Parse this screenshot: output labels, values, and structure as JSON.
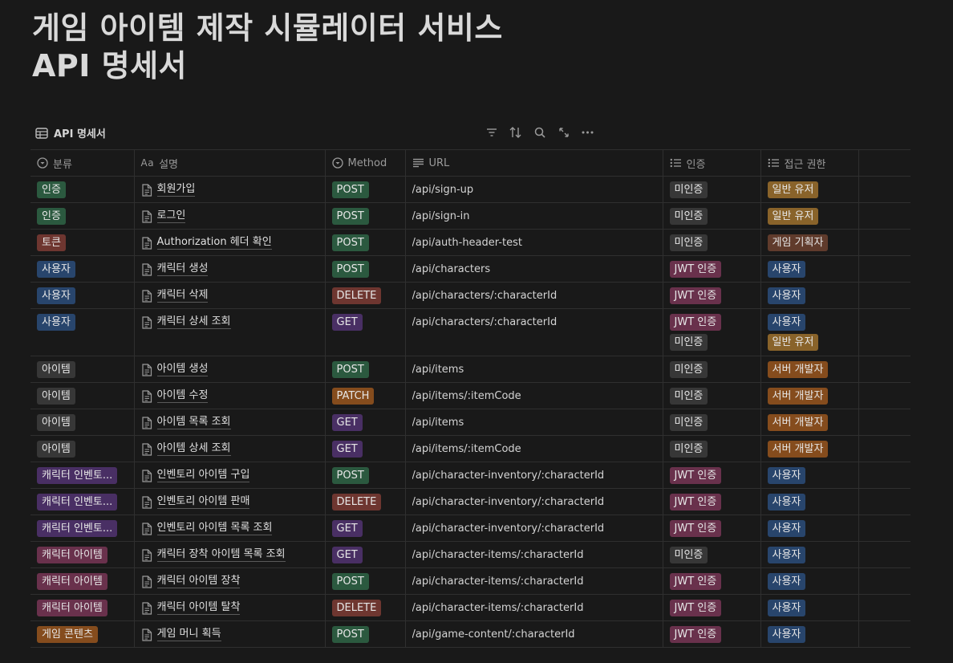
{
  "page": {
    "title_line1": "게임 아이템 제작 시뮬레이터 서비스",
    "title_line2": "API 명세서"
  },
  "database": {
    "name": "API 명세서",
    "icon": "table-icon",
    "toolbar": [
      "filter-icon",
      "sort-icon",
      "search-icon",
      "expand-icon",
      "more-icon"
    ]
  },
  "columns": [
    {
      "key": "category",
      "label": "분류",
      "icon": "select-icon"
    },
    {
      "key": "description",
      "label": "설명",
      "icon": "title-aa-icon",
      "prefix": "Aa"
    },
    {
      "key": "method",
      "label": "Method",
      "icon": "select-icon"
    },
    {
      "key": "url",
      "label": "URL",
      "icon": "text-icon"
    },
    {
      "key": "auth",
      "label": "인증",
      "icon": "multiselect-icon"
    },
    {
      "key": "access",
      "label": "접근 권한",
      "icon": "multiselect-icon"
    }
  ],
  "colors": {
    "green": "#2b593f",
    "red": "#6e3630",
    "blue": "#28456c",
    "gray": "#373737",
    "purple": "#492f64",
    "pink": "#69314c",
    "orange": "#854c1d",
    "brown": "#603b2c",
    "yellow": "#89632a"
  },
  "rows": [
    {
      "category": {
        "label": "인증",
        "color": "green"
      },
      "description": "회원가입",
      "method": {
        "label": "POST",
        "color": "green"
      },
      "url": "/api/sign-up",
      "auth": [
        {
          "label": "미인증",
          "color": "gray"
        }
      ],
      "access": [
        {
          "label": "일반 유저",
          "color": "yellow"
        }
      ]
    },
    {
      "category": {
        "label": "인증",
        "color": "green"
      },
      "description": "로그인",
      "method": {
        "label": "POST",
        "color": "green"
      },
      "url": "/api/sign-in",
      "auth": [
        {
          "label": "미인증",
          "color": "gray"
        }
      ],
      "access": [
        {
          "label": "일반 유저",
          "color": "yellow"
        }
      ]
    },
    {
      "category": {
        "label": "토큰",
        "color": "red"
      },
      "description": "Authorization 헤더 확인",
      "method": {
        "label": "POST",
        "color": "green"
      },
      "url": "/api/auth-header-test",
      "auth": [
        {
          "label": "미인증",
          "color": "gray"
        }
      ],
      "access": [
        {
          "label": "게임 기획자",
          "color": "brown"
        }
      ]
    },
    {
      "category": {
        "label": "사용자",
        "color": "blue"
      },
      "description": "캐릭터 생성",
      "method": {
        "label": "POST",
        "color": "green"
      },
      "url": "/api/characters",
      "auth": [
        {
          "label": "JWT 인증",
          "color": "pink"
        }
      ],
      "access": [
        {
          "label": "사용자",
          "color": "blue"
        }
      ]
    },
    {
      "category": {
        "label": "사용자",
        "color": "blue"
      },
      "description": "캐릭터 삭제",
      "method": {
        "label": "DELETE",
        "color": "red"
      },
      "url": "/api/characters/:characterId",
      "auth": [
        {
          "label": "JWT 인증",
          "color": "pink"
        }
      ],
      "access": [
        {
          "label": "사용자",
          "color": "blue"
        }
      ]
    },
    {
      "category": {
        "label": "사용자",
        "color": "blue"
      },
      "description": "캐릭터 상세 조회",
      "method": {
        "label": "GET",
        "color": "purple"
      },
      "url": "/api/characters/:characterId",
      "auth": [
        {
          "label": "JWT 인증",
          "color": "pink"
        },
        {
          "label": "미인증",
          "color": "gray"
        }
      ],
      "access": [
        {
          "label": "사용자",
          "color": "blue"
        },
        {
          "label": "일반 유저",
          "color": "yellow"
        }
      ]
    },
    {
      "category": {
        "label": "아이템",
        "color": "gray"
      },
      "description": "아이템 생성",
      "method": {
        "label": "POST",
        "color": "green"
      },
      "url": "/api/items",
      "auth": [
        {
          "label": "미인증",
          "color": "gray"
        }
      ],
      "access": [
        {
          "label": "서버 개발자",
          "color": "orange"
        }
      ]
    },
    {
      "category": {
        "label": "아이템",
        "color": "gray"
      },
      "description": "아이템 수정",
      "method": {
        "label": "PATCH",
        "color": "orange"
      },
      "url": "/api/items/:itemCode",
      "auth": [
        {
          "label": "미인증",
          "color": "gray"
        }
      ],
      "access": [
        {
          "label": "서버 개발자",
          "color": "orange"
        }
      ]
    },
    {
      "category": {
        "label": "아이템",
        "color": "gray"
      },
      "description": "아이템 목록 조회",
      "method": {
        "label": "GET",
        "color": "purple"
      },
      "url": "/api/items",
      "auth": [
        {
          "label": "미인증",
          "color": "gray"
        }
      ],
      "access": [
        {
          "label": "서버 개발자",
          "color": "orange"
        }
      ]
    },
    {
      "category": {
        "label": "아이템",
        "color": "gray"
      },
      "description": "아이템 상세 조회",
      "method": {
        "label": "GET",
        "color": "purple"
      },
      "url": "/api/items/:itemCode",
      "auth": [
        {
          "label": "미인증",
          "color": "gray"
        }
      ],
      "access": [
        {
          "label": "서버 개발자",
          "color": "orange"
        }
      ]
    },
    {
      "category": {
        "label": "캐릭터 인벤토...",
        "color": "purple"
      },
      "description": "인벤토리 아이템 구입",
      "method": {
        "label": "POST",
        "color": "green"
      },
      "url": "/api/character-inventory/:characterId",
      "auth": [
        {
          "label": "JWT 인증",
          "color": "pink"
        }
      ],
      "access": [
        {
          "label": "사용자",
          "color": "blue"
        }
      ]
    },
    {
      "category": {
        "label": "캐릭터 인벤토...",
        "color": "purple"
      },
      "description": "인벤토리 아이템 판매",
      "method": {
        "label": "DELETE",
        "color": "red"
      },
      "url": "/api/character-inventory/:characterId",
      "auth": [
        {
          "label": "JWT 인증",
          "color": "pink"
        }
      ],
      "access": [
        {
          "label": "사용자",
          "color": "blue"
        }
      ]
    },
    {
      "category": {
        "label": "캐릭터 인벤토...",
        "color": "purple"
      },
      "description": "인벤토리 아이템 목록 조회",
      "method": {
        "label": "GET",
        "color": "purple"
      },
      "url": "/api/character-inventory/:characterId",
      "auth": [
        {
          "label": "JWT 인증",
          "color": "pink"
        }
      ],
      "access": [
        {
          "label": "사용자",
          "color": "blue"
        }
      ]
    },
    {
      "category": {
        "label": "캐릭터 아이템",
        "color": "pink"
      },
      "description": "캐릭터 장착 아이템 목록 조회",
      "method": {
        "label": "GET",
        "color": "purple"
      },
      "url": "/api/character-items/:characterId",
      "auth": [
        {
          "label": "미인증",
          "color": "gray"
        }
      ],
      "access": [
        {
          "label": "사용자",
          "color": "blue"
        }
      ]
    },
    {
      "category": {
        "label": "캐릭터 아이템",
        "color": "pink"
      },
      "description": "캐릭터 아이템 장착",
      "method": {
        "label": "POST",
        "color": "green"
      },
      "url": "/api/character-items/:characterId",
      "auth": [
        {
          "label": "JWT 인증",
          "color": "pink"
        }
      ],
      "access": [
        {
          "label": "사용자",
          "color": "blue"
        }
      ]
    },
    {
      "category": {
        "label": "캐릭터 아이템",
        "color": "pink"
      },
      "description": "캐릭터 아이템 탈착",
      "method": {
        "label": "DELETE",
        "color": "red"
      },
      "url": "/api/character-items/:characterId",
      "auth": [
        {
          "label": "JWT 인증",
          "color": "pink"
        }
      ],
      "access": [
        {
          "label": "사용자",
          "color": "blue"
        }
      ]
    },
    {
      "category": {
        "label": "게임 콘텐츠",
        "color": "orange"
      },
      "description": "게임 머니 획득",
      "method": {
        "label": "POST",
        "color": "green"
      },
      "url": "/api/game-content/:characterId",
      "auth": [
        {
          "label": "JWT 인증",
          "color": "pink"
        }
      ],
      "access": [
        {
          "label": "사용자",
          "color": "blue"
        }
      ]
    }
  ]
}
